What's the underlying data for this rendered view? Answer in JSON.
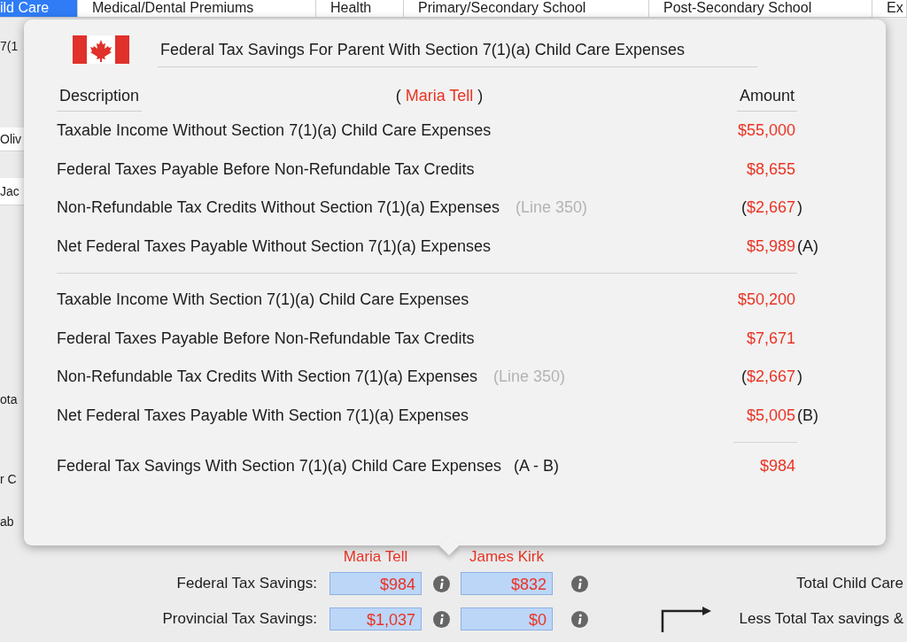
{
  "tabs": [
    {
      "label": "ild Care",
      "selected": true
    },
    {
      "label": "Medical/Dental Premiums",
      "selected": false
    },
    {
      "label": "Health",
      "selected": false
    },
    {
      "label": "Primary/Secondary School",
      "selected": false
    },
    {
      "label": "Post-Secondary School",
      "selected": false
    },
    {
      "label": "Ex",
      "selected": false
    }
  ],
  "side_fragments": [
    {
      "text": "7(1",
      "kind": "plain"
    },
    {
      "text": "Oliv",
      "kind": "row"
    },
    {
      "text": "Jac",
      "kind": "row"
    },
    {
      "text": "ota",
      "kind": "plain"
    },
    {
      "text": "r C",
      "kind": "plain"
    },
    {
      "text": "ab",
      "kind": "plain"
    }
  ],
  "people": [
    "Maria Tell",
    "James Kirk"
  ],
  "savings_rows": [
    {
      "label": "Federal Tax Savings:",
      "values": [
        "$984",
        "$832"
      ],
      "right_label": "Total Child Care"
    },
    {
      "label": "Provincial Tax Savings:",
      "values": [
        "$1,037",
        "$0"
      ],
      "right_label": "Less Total Tax savings &"
    }
  ],
  "popover": {
    "title": "Federal Tax Savings For Parent With Section 7(1)(a) Child Care Expenses",
    "header": {
      "description": "Description",
      "open": "(",
      "person": "Maria Tell",
      "close": ")",
      "amount": "Amount"
    },
    "sections": [
      [
        {
          "label": "Taxable Income Without Section 7(1)(a) Child Care Expenses",
          "amount": "$55,000"
        },
        {
          "label": "Federal Taxes Payable Before Non-Refundable Tax Credits",
          "amount": "$8,655"
        },
        {
          "label": "Non-Refundable Tax Credits Without Section 7(1)(a) Expenses",
          "note": "(Line 350)",
          "open": "(",
          "amount": "$2,667",
          "close": ")"
        },
        {
          "label": "Net Federal Taxes Payable Without Section 7(1)(a) Expenses",
          "amount": "$5,989",
          "marker": "(A)"
        }
      ],
      [
        {
          "label": "Taxable Income With Section 7(1)(a) Child Care Expenses",
          "amount": "$50,200"
        },
        {
          "label": "Federal Taxes Payable Before Non-Refundable Tax Credits",
          "amount": "$7,671"
        },
        {
          "label": "Non-Refundable Tax Credits With Section 7(1)(a) Expenses",
          "note": "(Line 350)",
          "open": "(",
          "amount": "$2,667",
          "close": ")"
        },
        {
          "label": "Net Federal Taxes Payable With Section 7(1)(a) Expenses",
          "amount": "$5,005",
          "marker": "(B)"
        }
      ]
    ],
    "total": {
      "label": "Federal Tax Savings With Section 7(1)(a) Child Care Expenses",
      "formula": "(A - B)",
      "amount": "$984"
    }
  }
}
